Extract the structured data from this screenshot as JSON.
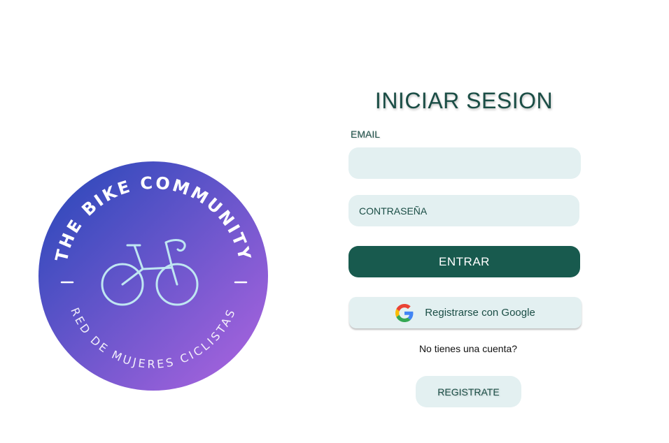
{
  "logo": {
    "top_text": "THE BIKE COMMUNITY",
    "bottom_text": "RED DE MUJERES CICLISTAS",
    "gradient_start": "#2447b8",
    "gradient_end": "#a463e0",
    "text_color": "#ffffff",
    "bike_color": "#bfe6f2"
  },
  "form": {
    "title": "INICIAR SESION",
    "email_label": "EMAIL",
    "email_value": "",
    "password_placeholder": "CONTRASEÑA",
    "enter_label": "ENTRAR",
    "google_label": "Registrarse con Google",
    "google_icon": "google-icon",
    "no_account_text": "No tienes una cuenta?",
    "register_label": "REGISTRATE"
  },
  "colors": {
    "primary": "#185a4e",
    "field_bg": "#e3f0f1",
    "text_dark": "#1a4d45"
  }
}
